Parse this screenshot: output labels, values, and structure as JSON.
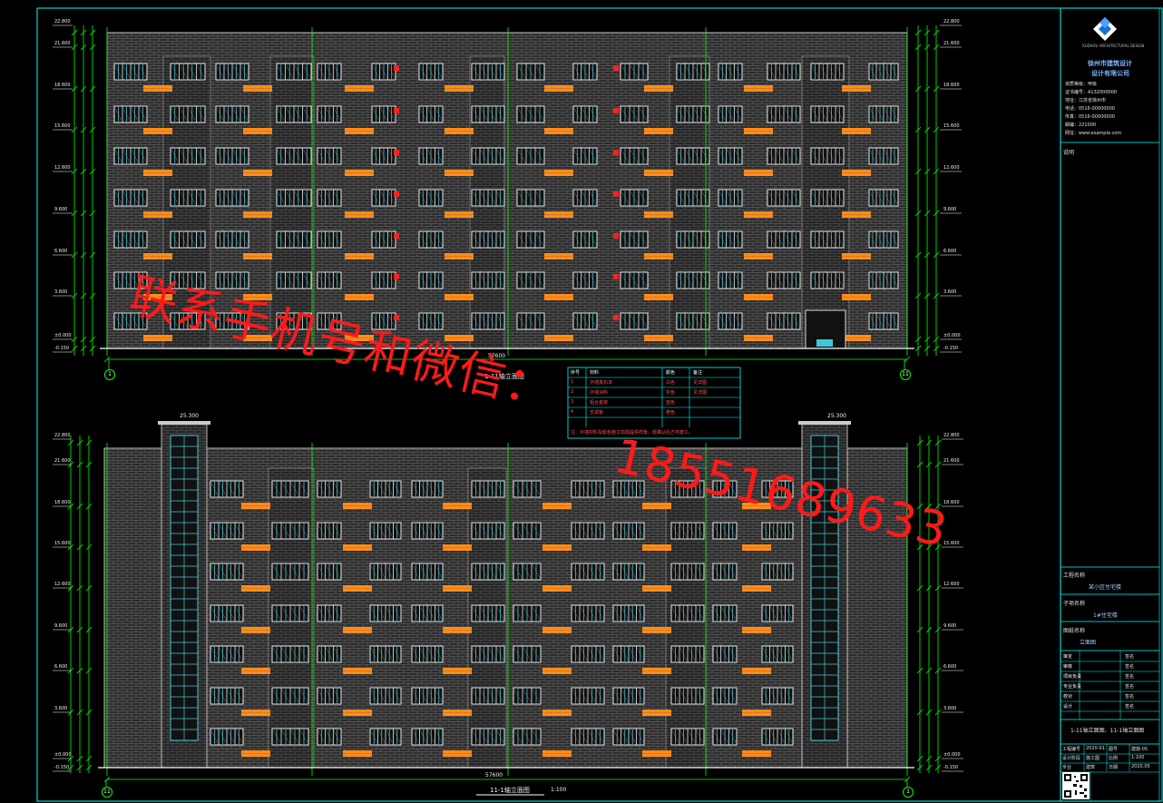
{
  "watermark": {
    "line1": "联系手机号和微信：",
    "line2": "18551689633"
  },
  "top_elevation": {
    "title": "1-11轴立面图",
    "dimension_total": "57600",
    "axis_left": "1",
    "axis_right": "11",
    "levels_left": [
      "22.800",
      "21.600",
      "18.600",
      "15.600",
      "12.600",
      "9.600",
      "6.600",
      "3.600",
      "±0.000",
      "-0.150"
    ],
    "levels_right": [
      "22.800",
      "21.600",
      "18.600",
      "15.600",
      "12.600",
      "9.600",
      "6.600",
      "3.600",
      "±0.000",
      "-0.150"
    ]
  },
  "bottom_elevation": {
    "title": "11-1轴立面图",
    "scale": "1:100",
    "dimension_total": "57600",
    "axis_left": "11",
    "axis_right": "1",
    "roof_left": "25.300",
    "roof_right": "25.300",
    "levels_left": [
      "22.800",
      "21.600",
      "18.600",
      "15.600",
      "12.600",
      "9.600",
      "6.600",
      "3.600",
      "±0.000",
      "-0.150"
    ],
    "levels_right": [
      "22.800",
      "21.600",
      "18.600",
      "15.600",
      "12.600",
      "9.600",
      "6.600",
      "3.600",
      "±0.000",
      "-0.150"
    ]
  },
  "legend_table": {
    "header": [
      "序号",
      "材料",
      "颜色",
      "备注"
    ],
    "rows": [
      [
        "1",
        "外墙真石漆",
        "白色",
        "见详图"
      ],
      [
        "2",
        "外墙涂料",
        "灰色",
        "见详图"
      ],
      [
        "3",
        "铝合金窗",
        "蓝色",
        ""
      ],
      [
        "4",
        "空调板",
        "橙色",
        ""
      ]
    ],
    "note": "注：外墙材料及颜色施工前需提供样板，经确认后方可施工。"
  },
  "title_block": {
    "company_line1": "徐州市建筑设计",
    "company_line2": "设计有限公司",
    "company_en": "XUZHOU ARCHITECTURAL DESIGN",
    "info_lines": [
      "资质等级：甲级",
      "证书编号：A132000000",
      "地址：江苏省徐州市",
      "电话：0516-00000000",
      "传真：0516-00000000",
      "邮编：221000",
      "网址：www.example.com"
    ],
    "note_label": "说明",
    "project_label": "工程名称",
    "project_value": "某小区住宅楼",
    "sub_label": "子项名称",
    "sub_value": "1#住宅楼",
    "drawing_label": "图纸名称",
    "drawing_value": "立面图",
    "sign_rows": [
      [
        "审定",
        "",
        "签名"
      ],
      [
        "审核",
        "",
        "签名"
      ],
      [
        "项目负责",
        "",
        "签名"
      ],
      [
        "专业负责",
        "",
        "签名"
      ],
      [
        "校对",
        "",
        "签名"
      ],
      [
        "设计",
        "",
        "签名"
      ]
    ],
    "drawing_name": "1-11轴立面图、11-1轴立面图",
    "footer_rows": [
      [
        "工程编号",
        "2020-01",
        "图号",
        "建施-05"
      ],
      [
        "设计阶段",
        "施工图",
        "比例",
        "1:100"
      ],
      [
        "专业",
        "建筑",
        "日期",
        "2020.05"
      ]
    ]
  },
  "colors": {
    "wall": "#3a3a3a",
    "brick_line": "#6a6a6a",
    "window_frame": "#e8e8e8",
    "glass": "#40c8d8",
    "ac_panel": "#ff8c1a",
    "dimension": "#00ff00",
    "axis": "#00ff00",
    "frame": "#00ffff",
    "red_mark": "#ff2020",
    "watermark": "#ff1a1a"
  }
}
